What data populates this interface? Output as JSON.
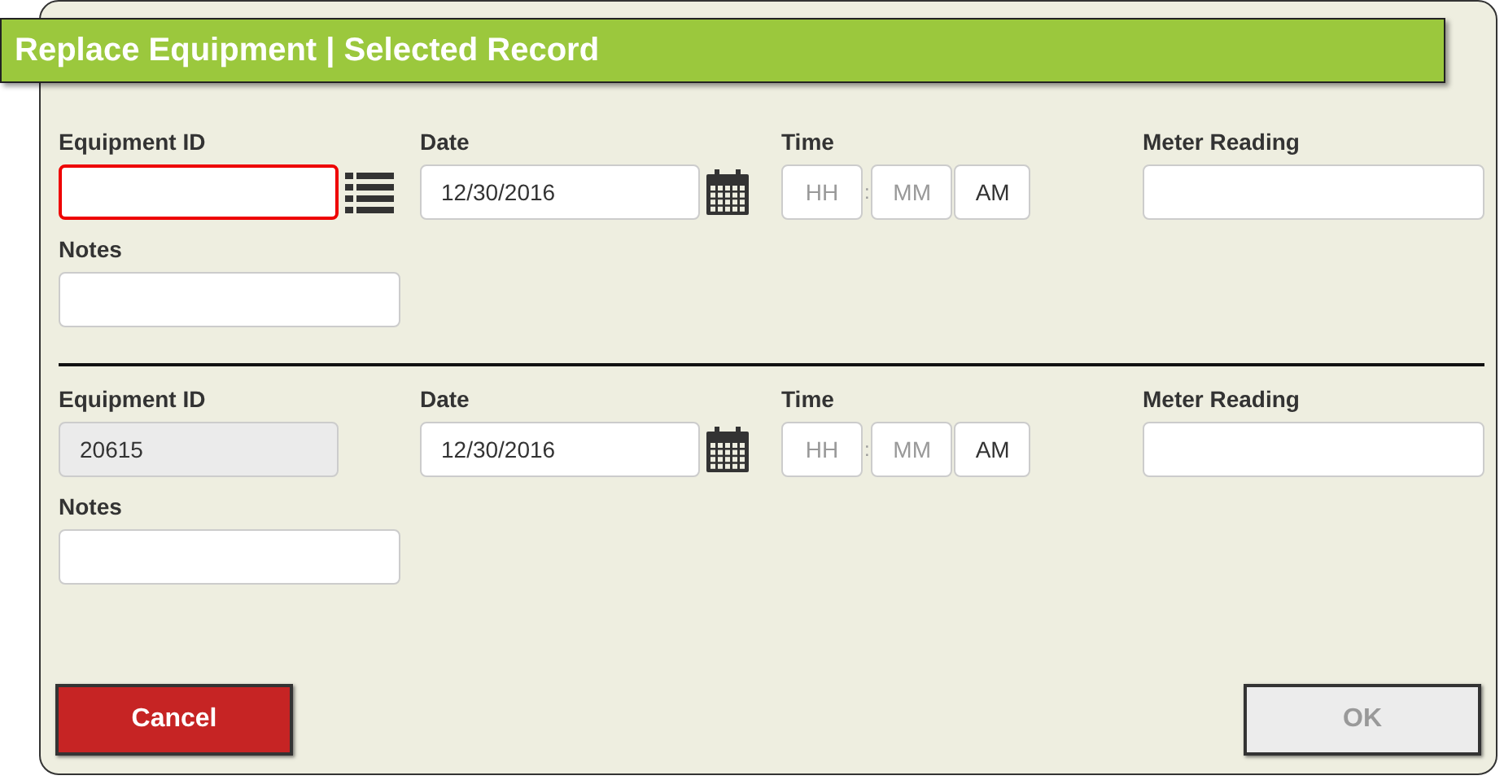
{
  "title": "Replace Equipment | Selected Record",
  "sections": [
    {
      "equipment_id": {
        "label": "Equipment ID",
        "invalid": true,
        "disabled": false,
        "lookup": true
      },
      "date": {
        "label": "Date",
        "value": "12/30/2016"
      },
      "time": {
        "label": "Time",
        "hour_placeholder": "HH",
        "separator": ":",
        "minute_placeholder": "MM",
        "period": "AM"
      },
      "meter_reading": {
        "label": "Meter Reading"
      },
      "notes": {
        "label": "Notes"
      }
    },
    {
      "equipment_id": {
        "label": "Equipment ID",
        "value": "20615",
        "invalid": false,
        "disabled": true,
        "lookup": false
      },
      "date": {
        "label": "Date",
        "value": "12/30/2016"
      },
      "time": {
        "label": "Time",
        "hour_placeholder": "HH",
        "separator": ":",
        "minute_placeholder": "MM",
        "period": "AM"
      },
      "meter_reading": {
        "label": "Meter Reading"
      },
      "notes": {
        "label": "Notes"
      }
    }
  ],
  "buttons": [
    {
      "label": "Cancel",
      "kind": "cancel",
      "disabled": false
    },
    {
      "label": "OK",
      "kind": "ok",
      "disabled": true
    }
  ]
}
